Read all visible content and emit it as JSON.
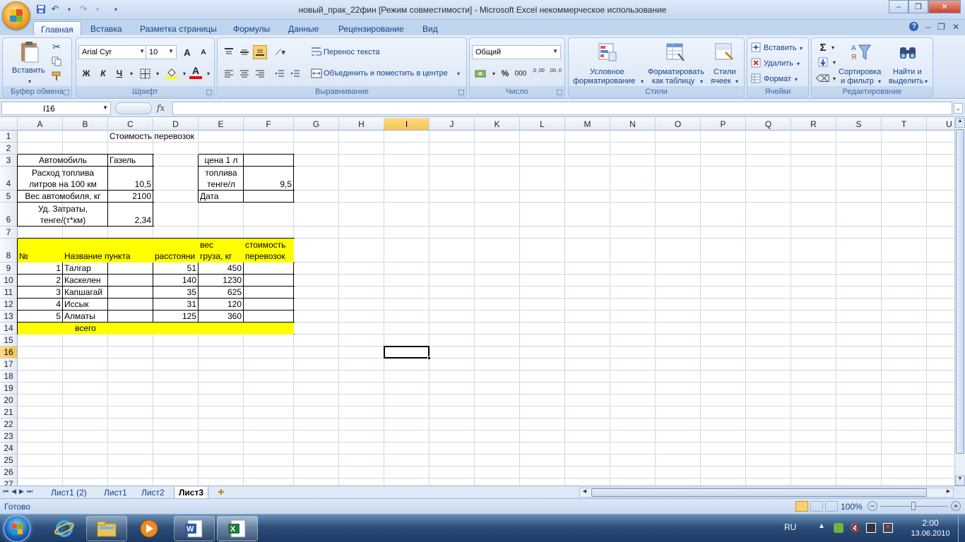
{
  "window": {
    "title": "новый_прак_22фин  [Режим совместимости] - Microsoft Excel некоммерческое использование",
    "minimize": "–",
    "restore": "❐",
    "close": "✕"
  },
  "ribbon_tabs": [
    "Главная",
    "Вставка",
    "Разметка страницы",
    "Формулы",
    "Данные",
    "Рецензирование",
    "Вид"
  ],
  "ribbon": {
    "clipboard": {
      "label": "Буфер обмена",
      "paste": "Вставить"
    },
    "font": {
      "label": "Шрифт",
      "font_name": "Arial Cyr",
      "font_size": "10",
      "bold": "Ж",
      "italic": "К",
      "underline": "Ч",
      "grow": "A",
      "shrink": "A",
      "font_color_letter": "A"
    },
    "alignment": {
      "label": "Выравнивание",
      "wrap_text": "Перенос текста",
      "merge_center": "Объединить и поместить в центре"
    },
    "number": {
      "label": "Число",
      "format": "Общий",
      "percent": "%",
      "thousands": "000",
      "inc_decimal": ",0 ,00",
      "dec_decimal": ",00 ,0"
    },
    "styles": {
      "label": "Стили",
      "conditional_l1": "Условное",
      "conditional_l2": "форматирование",
      "format_table_l1": "Форматировать",
      "format_table_l2": "как таблицу",
      "cell_styles_l1": "Стили",
      "cell_styles_l2": "ячеек"
    },
    "cells": {
      "label": "Ячейки",
      "insert": "Вставить",
      "delete": "Удалить",
      "format": "Формат"
    },
    "editing": {
      "label": "Редактирование",
      "sort_l1": "Сортировка",
      "sort_l2": "и фильтр",
      "find_l1": "Найти и",
      "find_l2": "выделить"
    }
  },
  "formula_bar": {
    "name_box": "I16",
    "fx": "fx",
    "value": ""
  },
  "columns": [
    "A",
    "B",
    "C",
    "D",
    "E",
    "F",
    "G",
    "H",
    "I",
    "J",
    "K",
    "L",
    "M",
    "N",
    "O",
    "P",
    "Q",
    "R",
    "S",
    "T",
    "U"
  ],
  "rows": [
    "1",
    "2",
    "3",
    "4",
    "5",
    "6",
    "7",
    "8",
    "9",
    "10",
    "11",
    "12",
    "13",
    "14",
    "15",
    "16",
    "17",
    "18",
    "19",
    "20",
    "21",
    "22",
    "23",
    "24",
    "25",
    "26",
    "27"
  ],
  "cells": {
    "c1": "Стоимость перевозок",
    "a3": "Автомобиль",
    "c3": "Газель",
    "e3": "цена  1 л",
    "a4_l1": "Расход топлива",
    "a4_l2": "литров на 100 км",
    "c4": "10,5",
    "e4_l1": "топлива",
    "e4_l2": "тенге/л",
    "f4": "9,5",
    "a5": "Вес автомобиля, кг",
    "c5": "2100",
    "e5": "Дата",
    "a6_l1": "Уд. Затраты,",
    "a6_l2": "тенге/(т*км)",
    "c6": "2,34",
    "a8": "№",
    "b8": "Название пункта",
    "d8": "расстояни",
    "e8_l1": "вес",
    "e8_l2": "груза, кг",
    "f8_l1": "стоимость",
    "f8_l2": "перевозок",
    "b14": "всего"
  },
  "table_rows": [
    {
      "n": "1",
      "name": "Талгар",
      "dist": "51",
      "weight": "450"
    },
    {
      "n": "2",
      "name": "Каскелен",
      "dist": "140",
      "weight": "1230"
    },
    {
      "n": "3",
      "name": "Капшагай",
      "dist": "35",
      "weight": "625"
    },
    {
      "n": "4",
      "name": "Иссык",
      "dist": "31",
      "weight": "120"
    },
    {
      "n": "5",
      "name": "Алматы",
      "dist": "125",
      "weight": "360"
    }
  ],
  "sheets": [
    "Лист1 (2)",
    "Лист1",
    "Лист2",
    "Лист3"
  ],
  "active_sheet": "Лист3",
  "status": {
    "ready": "Готово",
    "zoom": "100%"
  },
  "taskbar": {
    "lang": "RU",
    "time": "2:00",
    "date": "13.06.2010"
  },
  "colors": {
    "highlight": "#ffff00",
    "selection_header": "#f7c44f"
  }
}
